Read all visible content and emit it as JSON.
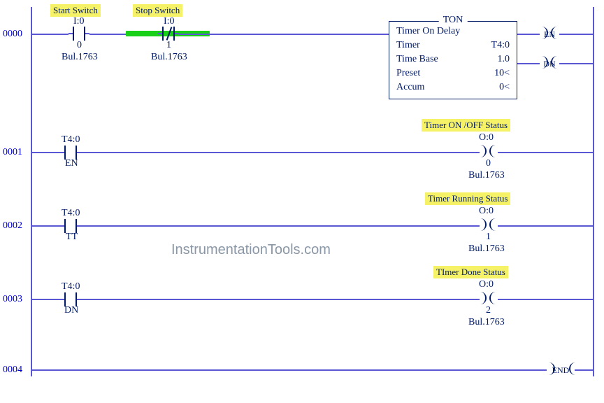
{
  "rung0": {
    "num": "0000",
    "start": {
      "label": "Start Switch",
      "addr": "I:0",
      "bit": "0",
      "bul": "Bul.1763"
    },
    "stop": {
      "label": "Stop Switch",
      "addr": "I:0",
      "bit": "1",
      "bul": "Bul.1763"
    },
    "ton": {
      "title": "TON",
      "l1": "Timer On Delay",
      "l2k": "Timer",
      "l2v": "T4:0",
      "l3k": "Time Base",
      "l3v": "1.0",
      "l4k": "Preset",
      "l4v": "10<",
      "l5k": "Accum",
      "l5v": "0<"
    },
    "en": "EN",
    "dn": "DN"
  },
  "rung1": {
    "num": "0001",
    "contact": {
      "addr": "T4:0",
      "bit": "EN"
    },
    "out": {
      "label": "Timer ON /OFF Status",
      "addr": "O:0",
      "bit": "0",
      "bul": "Bul.1763"
    }
  },
  "rung2": {
    "num": "0002",
    "contact": {
      "addr": "T4:0",
      "bit": "TT"
    },
    "out": {
      "label": "Timer Running Status",
      "addr": "O:0",
      "bit": "1",
      "bul": "Bul.1763"
    }
  },
  "rung3": {
    "num": "0003",
    "contact": {
      "addr": "T4:0",
      "bit": "DN"
    },
    "out": {
      "label": "TImer Done Status",
      "addr": "O:0",
      "bit": "2",
      "bul": "Bul.1763"
    }
  },
  "rung4": {
    "num": "0004",
    "end": "END"
  },
  "watermark": "InstrumentationTools.com"
}
